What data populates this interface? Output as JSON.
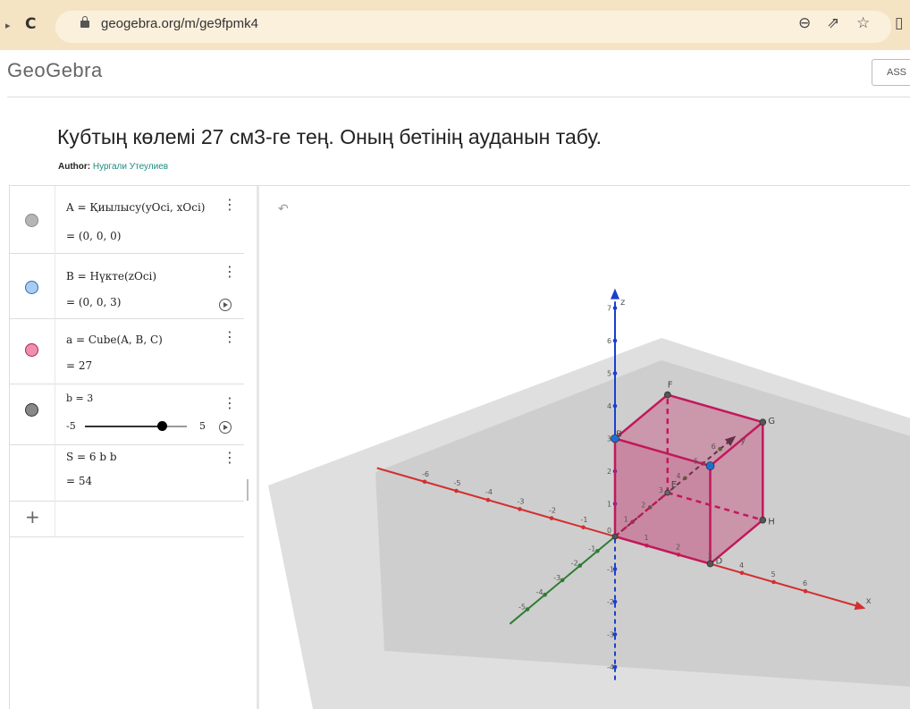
{
  "browser": {
    "url": "geogebra.org/m/ge9fpmk4",
    "icons": [
      "back-arrow-icon",
      "reload-icon",
      "lock-icon",
      "zoom-icon",
      "share-icon",
      "bookmark-star-icon",
      "sidebar-icon"
    ]
  },
  "header": {
    "logo": "GeoGebra",
    "assign_label": "ASS"
  },
  "page": {
    "title": "Кубтың көлемі 27 см3-ге тең. Оның бетінің ауданын табу.",
    "author_label": "Author:",
    "author_name": "Нургали Утеулиев"
  },
  "algebra": {
    "rows": [
      {
        "def": "A  =  Қиылысу(yOci, xOci)",
        "value": "=  (0, 0, 0)",
        "color": "#b5b5b5"
      },
      {
        "def": "B  =  Нүкте(zOci)",
        "value": "=  (0, 0, 3)",
        "color": "#a8cdf2"
      },
      {
        "def": "a  =  Cube(A, B, C)",
        "value": "=  27",
        "color": "#ee8fb0"
      },
      {
        "def": "b = 3",
        "slider_min": "-5",
        "slider_max": "5",
        "slider_value": 3,
        "color": "#888888"
      },
      {
        "def": "S  =  6 b b",
        "value": "=  54"
      }
    ],
    "add_label": "+"
  },
  "graphics": {
    "axis_labels": {
      "x": "x",
      "y": "y",
      "z": "z"
    },
    "point_labels": [
      "F",
      "G",
      "H",
      "E",
      "B",
      "D"
    ],
    "x_ticks": [
      "-6",
      "-5",
      "-4",
      "-3",
      "-2",
      "-1",
      "0",
      "1",
      "2",
      "3",
      "4",
      "5",
      "6"
    ],
    "z_ticks": [
      "7",
      "6",
      "5",
      "4",
      "3",
      "2",
      "1",
      "-1",
      "-2",
      "-3",
      "-4"
    ],
    "y_ticks": [
      "-5",
      "-4",
      "-3",
      "-2",
      "-1",
      "1",
      "2",
      "3",
      "4",
      "5",
      "6"
    ]
  },
  "colors": {
    "cube": "#c2185b",
    "x_axis": "#d32f2f",
    "y_axis": "#2e7d32",
    "z_axis": "#1a3fcf",
    "point_B": "#1f6fd1"
  }
}
